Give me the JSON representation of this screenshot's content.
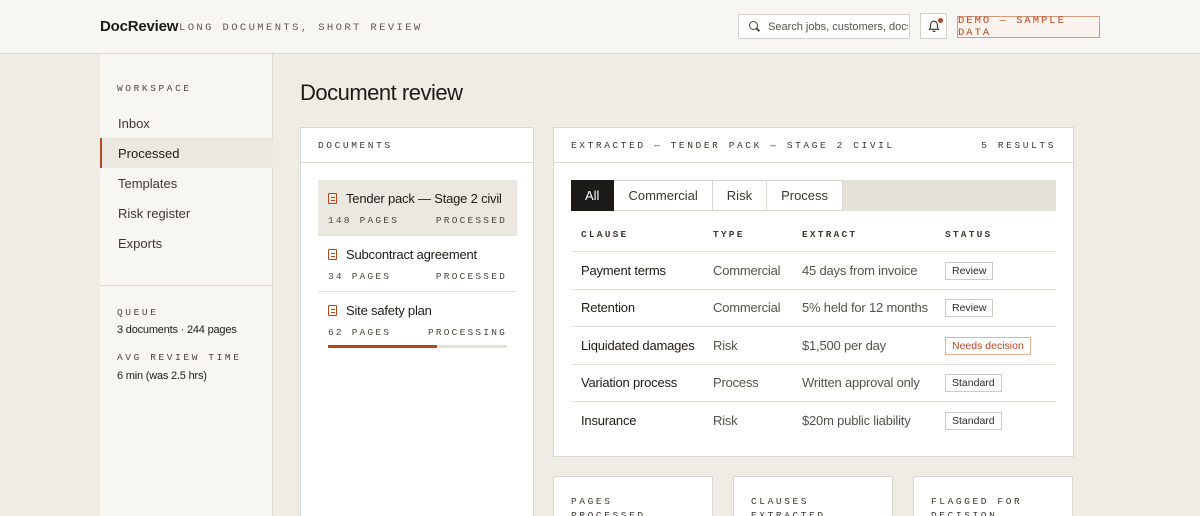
{
  "header": {
    "brand": "DocReview",
    "tagline": "Long documents, short review",
    "search_placeholder": "Search jobs, customers, docs",
    "demo_badge": "Demo — sample data"
  },
  "sidebar": {
    "heading": "Workspace",
    "items": [
      {
        "label": "Inbox"
      },
      {
        "label": "Processed"
      },
      {
        "label": "Templates"
      },
      {
        "label": "Risk register"
      },
      {
        "label": "Exports"
      }
    ],
    "queue_label": "Queue",
    "queue_value": "3 documents · 244 pages",
    "avg_label": "Avg review time",
    "avg_value": "6 min (was 2.5 hrs)"
  },
  "main": {
    "title": "Document review",
    "documents": {
      "heading": "Documents",
      "items": [
        {
          "name": "Tender pack — Stage 2 civil",
          "pages": "148 pages",
          "status": "Processed"
        },
        {
          "name": "Subcontract agreement",
          "pages": "34 pages",
          "status": "Processed"
        },
        {
          "name": "Site safety plan",
          "pages": "62 pages",
          "status": "Processing",
          "progress": 0.61
        }
      ]
    },
    "extracted": {
      "heading": "Extracted — Tender pack — Stage 2 civil",
      "results": "5 results",
      "tabs": [
        "All",
        "Commercial",
        "Risk",
        "Process"
      ],
      "columns": [
        "Clause",
        "Type",
        "Extract",
        "Status"
      ],
      "rows": [
        {
          "clause": "Payment terms",
          "type": "Commercial",
          "extract": "45 days from invoice",
          "status": "Review"
        },
        {
          "clause": "Retention",
          "type": "Commercial",
          "extract": "5% held for 12 months",
          "status": "Review"
        },
        {
          "clause": "Liquidated damages",
          "type": "Risk",
          "extract": "$1,500 per day",
          "status": "Needs decision"
        },
        {
          "clause": "Variation process",
          "type": "Process",
          "extract": "Written approval only",
          "status": "Standard"
        },
        {
          "clause": "Insurance",
          "type": "Risk",
          "extract": "$20m public liability",
          "status": "Standard"
        }
      ]
    },
    "stats": [
      {
        "label": "Pages processed"
      },
      {
        "label": "Clauses extracted"
      },
      {
        "label": "Flagged for decision"
      }
    ]
  },
  "colors": {
    "accent": "#b6471c",
    "background": "#efece6",
    "surface": "#ffffff"
  }
}
